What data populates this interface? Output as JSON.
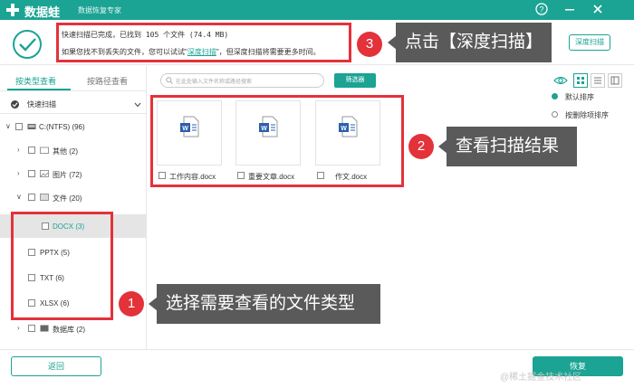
{
  "titlebar": {
    "app_name": "数据蛙",
    "app_subtitle": "数据恢复专家",
    "help_icon": "?",
    "min_icon": "−",
    "close_icon": "✕"
  },
  "status": {
    "line1": "快速扫描已完成，已找到 105 个文件 (74.4 MB)",
    "line2_prefix": "如果您找不到丢失的文件，您可以试试\"",
    "line2_link": "深度扫描",
    "line2_suffix": "\"，但深度扫描将需要更多时间。",
    "deep_scan_button": "深度扫描"
  },
  "sidebar": {
    "tab_type": "按类型查看",
    "tab_path": "按路径查看",
    "quick_scan": "快速扫描",
    "tree": [
      {
        "label": "C:(NTFS) (96)"
      },
      {
        "label": "其他 (2)"
      },
      {
        "label": "图片 (72)"
      },
      {
        "label": "文件 (20)"
      },
      {
        "label": "DOCX (3)"
      },
      {
        "label": "PPTX (5)"
      },
      {
        "label": "TXT (6)"
      },
      {
        "label": "XLSX (6)"
      },
      {
        "label": "数据库 (2)"
      }
    ]
  },
  "toolbar": {
    "search_placeholder": "在此处输入文件名称或路径搜索",
    "filter_button": "筛选器"
  },
  "sort": {
    "default": "默认排序",
    "by_deleted": "按删除项排序"
  },
  "files": [
    {
      "name": "工作内容.docx"
    },
    {
      "name": "重要文章.docx"
    },
    {
      "name": "作文.docx"
    }
  ],
  "footer": {
    "back_button": "返回",
    "recover_button": "恢复",
    "watermark": "@稀土掘金技术社区"
  },
  "annotations": {
    "step1_num": "1",
    "step1_text": "选择需要查看的文件类型",
    "step2_num": "2",
    "step2_text": "查看扫描结果",
    "step3_num": "3",
    "step3_text": "点击【深度扫描】"
  },
  "colors": {
    "accent": "#1ba394",
    "annotation_red": "#e3323a",
    "callout_bg": "#5a5a5a"
  }
}
